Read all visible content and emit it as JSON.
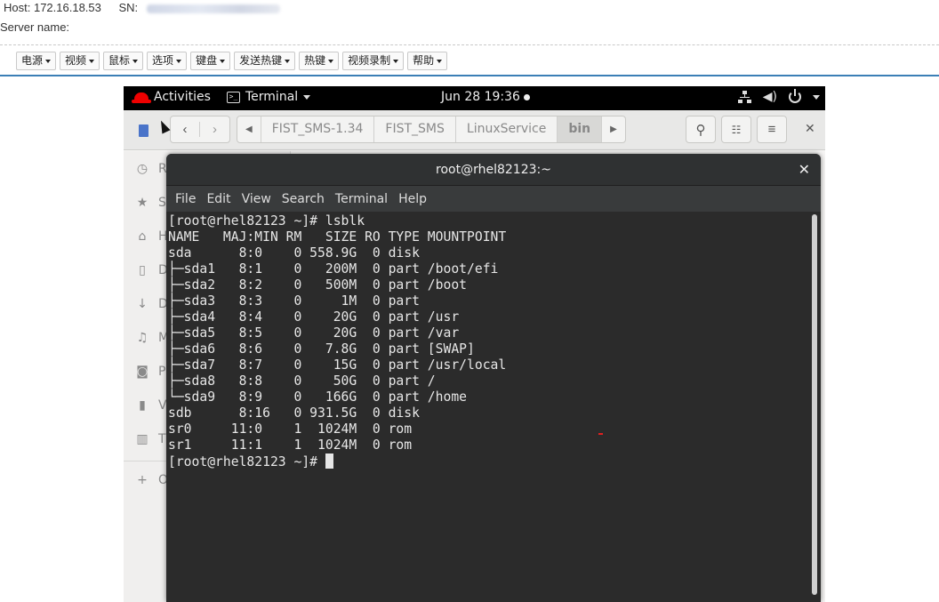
{
  "kvm": {
    "host_label": "Host:",
    "host_value": "172.16.18.53",
    "sn_label": "SN:",
    "server_name_label": "Server name:",
    "toolbar": [
      "电源",
      "视频",
      "鼠标",
      "选项",
      "键盘",
      "发送热键",
      "热键",
      "视频录制",
      "帮助"
    ]
  },
  "gnome": {
    "activities": "Activities",
    "app_menu": "Terminal",
    "clock": "Jun 28  19:36"
  },
  "nautilus": {
    "path": [
      "FIST_SMS-1.34",
      "FIST_SMS",
      "LinuxService",
      "bin"
    ],
    "active_path": "bin",
    "sidebar": [
      {
        "icon": "clock-icon",
        "glyph": "◷",
        "label": "R"
      },
      {
        "icon": "star-icon",
        "glyph": "★",
        "label": "S"
      },
      {
        "icon": "home-icon",
        "glyph": "⌂",
        "label": "H"
      },
      {
        "icon": "document-icon",
        "glyph": "▯",
        "label": "D"
      },
      {
        "icon": "download-icon",
        "glyph": "↓",
        "label": "D"
      },
      {
        "icon": "music-icon",
        "glyph": "♫",
        "label": "M"
      },
      {
        "icon": "camera-icon",
        "glyph": "◙",
        "label": "Pi"
      },
      {
        "icon": "video-icon",
        "glyph": "▮",
        "label": "V"
      },
      {
        "icon": "trash-icon",
        "glyph": "▥",
        "label": "T"
      },
      {
        "icon": "plus-icon",
        "glyph": "+",
        "label": "O"
      }
    ]
  },
  "terminal": {
    "title": "root@rhel82123:~",
    "close_glyph": "✕",
    "menu": [
      "File",
      "Edit",
      "View",
      "Search",
      "Terminal",
      "Help"
    ],
    "lines": [
      "[root@rhel82123 ~]# lsblk",
      "NAME   MAJ:MIN RM   SIZE RO TYPE MOUNTPOINT",
      "sda      8:0    0 558.9G  0 disk",
      "├─sda1   8:1    0   200M  0 part /boot/efi",
      "├─sda2   8:2    0   500M  0 part /boot",
      "├─sda3   8:3    0     1M  0 part",
      "├─sda4   8:4    0    20G  0 part /usr",
      "├─sda5   8:5    0    20G  0 part /var",
      "├─sda6   8:6    0   7.8G  0 part [SWAP]",
      "├─sda7   8:7    0    15G  0 part /usr/local",
      "├─sda8   8:8    0    50G  0 part /",
      "└─sda9   8:9    0   166G  0 part /home",
      "sdb      8:16   0 931.5G  0 disk",
      "sr0     11:0    1  1024M  0 rom",
      "sr1     11:1    1  1024M  0 rom"
    ],
    "prompt": "[root@rhel82123 ~]# "
  }
}
